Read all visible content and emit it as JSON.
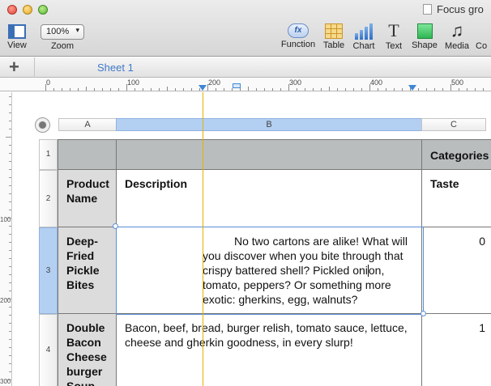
{
  "window": {
    "title": "Focus gro"
  },
  "toolbar": {
    "view_label": "View",
    "zoom_value": "100%",
    "zoom_label": "Zoom",
    "function_label": "Function",
    "function_icon_text": "fx",
    "table_label": "Table",
    "chart_label": "Chart",
    "text_label": "Text",
    "text_icon_glyph": "T",
    "shape_label": "Shape",
    "media_label": "Media",
    "cut_label": "Co",
    "media_icon_glyph": "♫"
  },
  "tabs": {
    "add_glyph": "+",
    "sheet_name": "Sheet 1"
  },
  "ruler": {
    "labels": [
      "0",
      "100",
      "200",
      "300",
      "400",
      "500"
    ]
  },
  "vruler": {
    "labels": [
      "100",
      "200",
      "300"
    ]
  },
  "sheet": {
    "columns": [
      "A",
      "B",
      "C"
    ],
    "rows": [
      "1",
      "2",
      "3",
      "4"
    ],
    "header_row": {
      "c": "Categories"
    },
    "row2": {
      "a": "Product Name",
      "b": "Description",
      "c": "Taste"
    },
    "row3": {
      "a": "Deep-Fried Pickle Bites",
      "b_line1": "No two cartons are alike! What will",
      "b_line2": "you discover when you bite through that",
      "b_line3_pre": "crispy battered shell? Pickled oni",
      "b_line3_post": "on,",
      "b_line4": "tomato, peppers? Or something more",
      "b_line5": "exotic: gherkins, egg, walnuts?",
      "c": "0"
    },
    "row4": {
      "a": "Double Bacon Cheese burger Soup",
      "b": "Bacon, beef, bread, burger relish, tomato sauce, lettuce, cheese and gherkin goodness, in every slurp!",
      "c": "1"
    }
  },
  "colors": {
    "accent": "#3f79c8",
    "selection": "#b3cff2",
    "guide": "#e2b200",
    "header_band": "#b9bdbd"
  }
}
